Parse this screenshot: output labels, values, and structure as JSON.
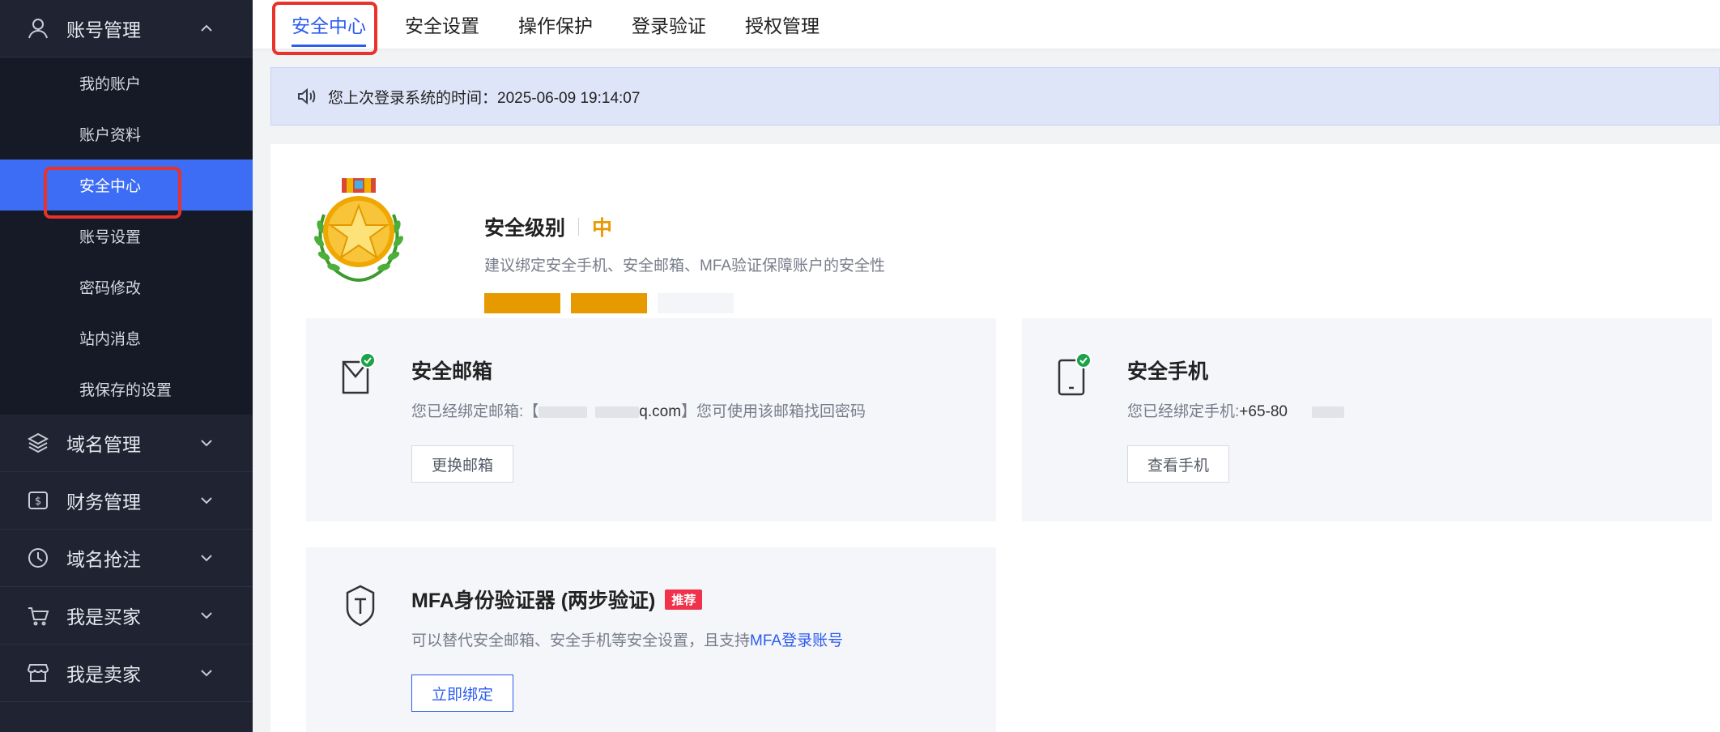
{
  "sidebar": {
    "account_group": {
      "label": "账号管理",
      "icon": "user-icon",
      "expanded": true
    },
    "items": [
      {
        "label": "我的账户"
      },
      {
        "label": "账户资料"
      },
      {
        "label": "安全中心",
        "active": true
      },
      {
        "label": "账号设置"
      },
      {
        "label": "密码修改"
      },
      {
        "label": "站内消息"
      },
      {
        "label": "我保存的设置"
      }
    ],
    "groups": [
      {
        "label": "域名管理",
        "icon": "layers-icon"
      },
      {
        "label": "财务管理",
        "icon": "dollar-icon"
      },
      {
        "label": "域名抢注",
        "icon": "clock-icon"
      },
      {
        "label": "我是买家",
        "icon": "cart-icon"
      },
      {
        "label": "我是卖家",
        "icon": "store-icon"
      }
    ]
  },
  "tabs": [
    {
      "label": "安全中心",
      "active": true
    },
    {
      "label": "安全设置"
    },
    {
      "label": "操作保护"
    },
    {
      "label": "登录验证"
    },
    {
      "label": "授权管理"
    }
  ],
  "notice": {
    "text": "您上次登录系统的时间：2025-06-09 19:14:07",
    "icon": "speaker-icon"
  },
  "security_level": {
    "title": "安全级别",
    "level": "中",
    "description": "建议绑定安全手机、安全邮箱、MFA验证保障账户的安全性",
    "bars_filled": 2,
    "bars_total": 3,
    "color": "#e69a00"
  },
  "cards": {
    "email": {
      "title": "安全邮箱",
      "desc_prefix": "您已经绑定邮箱:【",
      "desc_domain": "q.com",
      "desc_suffix": "】您可使用该邮箱找回密码",
      "button": "更换邮箱"
    },
    "phone": {
      "title": "安全手机",
      "desc_prefix": "您已经绑定手机:",
      "desc_number": "+65-80",
      "button": "查看手机"
    },
    "mfa": {
      "title": "MFA身份验证器 (两步验证)",
      "badge": "推荐",
      "desc_prefix": "可以替代安全邮箱、安全手机等安全设置，且支持",
      "desc_link": "MFA登录账号",
      "button": "立即绑定"
    }
  },
  "colors": {
    "accent": "#2b5bf0",
    "sidebar_bg": "#1f2332",
    "active_item": "#3d6cf5",
    "highlight": "#e8322a",
    "badge": "#f0324a"
  }
}
